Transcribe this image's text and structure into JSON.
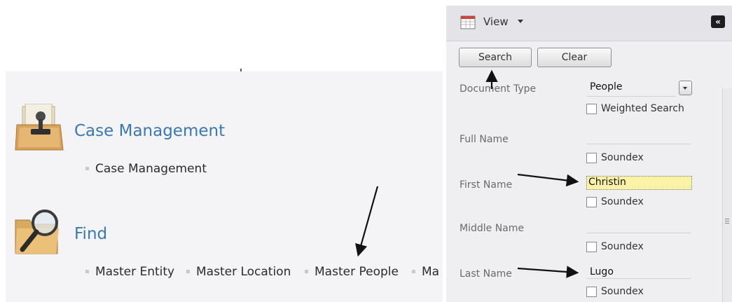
{
  "left": {
    "case_management": {
      "title": "Case Management",
      "links": [
        "Case Management"
      ]
    },
    "find": {
      "title": "Find",
      "links": [
        "Master Entity",
        "Master Location",
        "Master People",
        "Ma"
      ]
    }
  },
  "right": {
    "toolbar": {
      "view_label": "View",
      "collapse_glyph": "«"
    },
    "buttons": {
      "search": "Search",
      "clear": "Clear"
    },
    "fields": {
      "document_type": {
        "label": "Document Type",
        "value": "People",
        "checkbox": "Weighted Search"
      },
      "full_name": {
        "label": "Full Name",
        "value": "",
        "checkbox": "Soundex"
      },
      "first_name": {
        "label": "First Name",
        "value": "Christin",
        "checkbox": "Soundex"
      },
      "middle_name": {
        "label": "Middle Name",
        "value": "",
        "checkbox": "Soundex"
      },
      "last_name": {
        "label": "Last Name",
        "value": "Lugo",
        "checkbox": "Soundex"
      }
    }
  },
  "colors": {
    "title_blue": "#3a78b4",
    "highlight_input": "#fdf3a6"
  },
  "icons": [
    "stamp-folder-icon",
    "magnifier-folder-icon",
    "calendar-view-icon",
    "collapse-double-chevron-icon",
    "dropdown-caret-icon"
  ]
}
